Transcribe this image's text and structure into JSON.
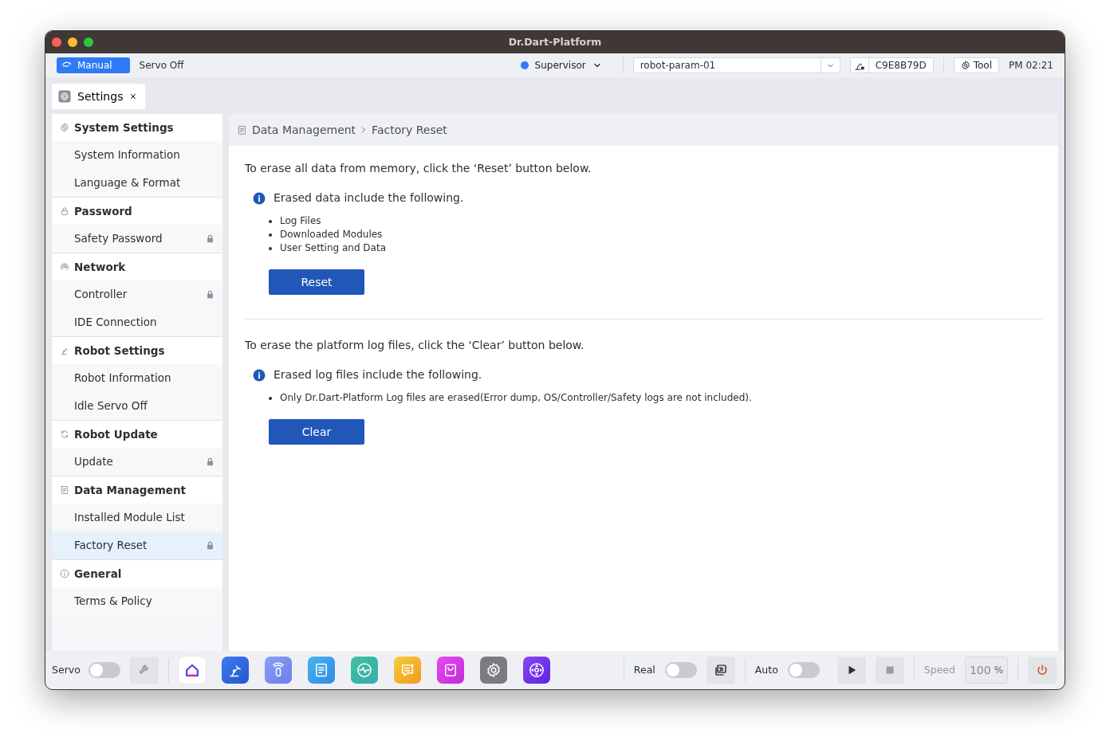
{
  "window": {
    "title": "Dr.Dart-Platform"
  },
  "toolbar": {
    "mode": {
      "label": "Manual",
      "selected": true
    },
    "servo_status": "Servo Off",
    "user": {
      "label": "Supervisor",
      "color": "#2f7bf5"
    },
    "param_select": {
      "value": "robot-param-01"
    },
    "serial": "C9E8B79D",
    "tool_button": "Tool",
    "time": "PM 02:21"
  },
  "tabs": [
    {
      "label": "Settings",
      "selected": true
    }
  ],
  "sidebar": {
    "groups": [
      {
        "title": "System Settings",
        "kind": "gear",
        "items": [
          {
            "label": "System Information",
            "locked": false,
            "selected": false
          },
          {
            "label": "Language & Format",
            "locked": false,
            "selected": false
          }
        ]
      },
      {
        "title": "Password",
        "kind": "lock",
        "items": [
          {
            "label": "Safety Password",
            "locked": true,
            "selected": false
          }
        ]
      },
      {
        "title": "Network",
        "kind": "network",
        "items": [
          {
            "label": "Controller",
            "locked": true,
            "selected": false
          },
          {
            "label": "IDE Connection",
            "locked": false,
            "selected": false
          }
        ]
      },
      {
        "title": "Robot Settings",
        "kind": "robot",
        "items": [
          {
            "label": "Robot Information",
            "locked": false,
            "selected": false
          },
          {
            "label": "Idle Servo Off",
            "locked": false,
            "selected": false
          }
        ]
      },
      {
        "title": "Robot Update",
        "kind": "refresh",
        "items": [
          {
            "label": "Update",
            "locked": true,
            "selected": false
          }
        ]
      },
      {
        "title": "Data Management",
        "kind": "document",
        "items": [
          {
            "label": "Installed Module List",
            "locked": false,
            "selected": false
          },
          {
            "label": "Factory Reset",
            "locked": true,
            "selected": true
          }
        ]
      },
      {
        "title": "General",
        "kind": "info",
        "items": [
          {
            "label": "Terms & Policy",
            "locked": false,
            "selected": false
          }
        ]
      }
    ]
  },
  "breadcrumb": [
    "Data Management",
    "Factory Reset"
  ],
  "sections": [
    {
      "instruction": "To erase all data from memory, click the ‘Reset’ button below.",
      "note": "Erased data include the following.",
      "bullets": [
        "Log Files",
        "Downloaded Modules",
        "User Setting and Data"
      ],
      "button": "Reset"
    },
    {
      "instruction": "To erase the platform log files, click the ‘Clear’ button below.",
      "note": "Erased log files include the following.",
      "bullets": [
        "Only Dr.Dart-Platform Log files are erased(Error dump, OS/Controller/Safety logs are not included)."
      ],
      "button": "Clear"
    }
  ],
  "bottom_bar": {
    "servo": {
      "label": "Servo",
      "on": false
    },
    "apps": [
      {
        "kind": "home"
      },
      {
        "kind": "robot"
      },
      {
        "kind": "remote"
      },
      {
        "kind": "document"
      },
      {
        "kind": "pulse"
      },
      {
        "kind": "chat"
      },
      {
        "kind": "bag"
      },
      {
        "kind": "gear"
      },
      {
        "kind": "joystick"
      }
    ],
    "real": {
      "label": "Real",
      "on": false
    },
    "auto": {
      "label": "Auto",
      "on": false
    },
    "speed": {
      "label": "Speed",
      "value": "100",
      "unit": "%"
    }
  }
}
